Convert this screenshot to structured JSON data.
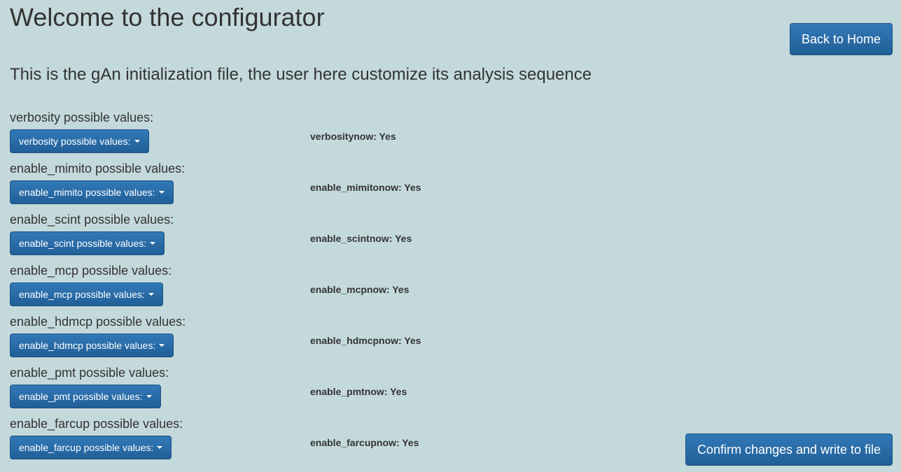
{
  "header": {
    "title": "Welcome to the configurator",
    "subtitle": "This is the gAn initialization file, the user here customize its analysis sequence"
  },
  "actions": {
    "back_label": "Back to Home",
    "confirm_label": "Confirm changes and write to file"
  },
  "colors": {
    "background": "#c4d9dc",
    "button_primary": "#2b6ca8",
    "text": "#333333"
  },
  "settings": [
    {
      "label": "verbosity possible values:",
      "dropdown_label": "verbosity possible values:",
      "current": "verbositynow: Yes"
    },
    {
      "label": "enable_mimito possible values:",
      "dropdown_label": "enable_mimito possible values:",
      "current": "enable_mimitonow: Yes"
    },
    {
      "label": "enable_scint possible values:",
      "dropdown_label": "enable_scint possible values:",
      "current": "enable_scintnow: Yes"
    },
    {
      "label": "enable_mcp possible values:",
      "dropdown_label": "enable_mcp possible values:",
      "current": "enable_mcpnow: Yes"
    },
    {
      "label": "enable_hdmcp possible values:",
      "dropdown_label": "enable_hdmcp possible values:",
      "current": "enable_hdmcpnow: Yes"
    },
    {
      "label": "enable_pmt possible values:",
      "dropdown_label": "enable_pmt possible values:",
      "current": "enable_pmtnow: Yes"
    },
    {
      "label": "enable_farcup possible values:",
      "dropdown_label": "enable_farcup possible values:",
      "current": "enable_farcupnow: Yes"
    }
  ]
}
